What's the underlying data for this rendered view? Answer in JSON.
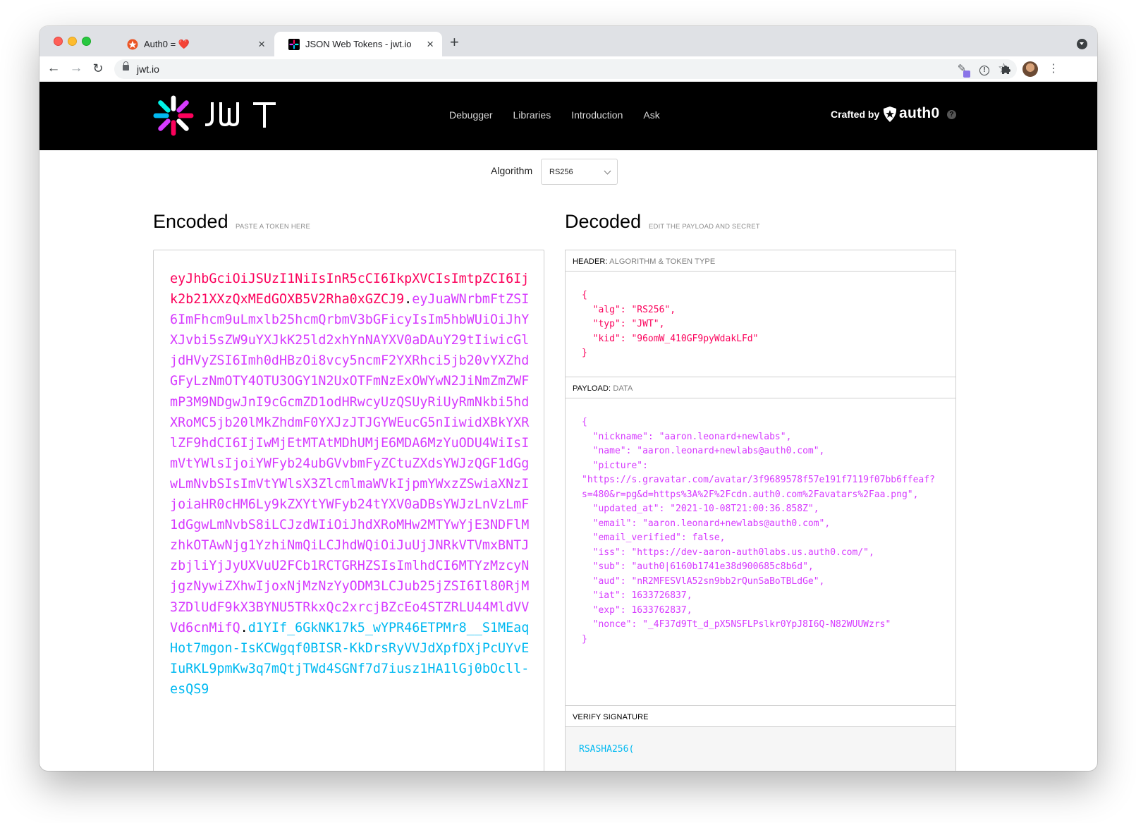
{
  "browser": {
    "tabs": [
      {
        "title": "Auth0 = ❤️",
        "active": false
      },
      {
        "title": "JSON Web Tokens - jwt.io",
        "active": true
      }
    ],
    "url": "jwt.io",
    "new_tab": "+",
    "close_glyph": "×"
  },
  "site": {
    "logo_text": "JWT",
    "nav": [
      "Debugger",
      "Libraries",
      "Introduction",
      "Ask"
    ],
    "crafted_by": "Crafted by",
    "auth0": "auth0",
    "help": "?"
  },
  "algorithm": {
    "label": "Algorithm",
    "value": "RS256"
  },
  "encoded": {
    "title": "Encoded",
    "subtitle": "PASTE A TOKEN HERE",
    "header_part": "eyJhbGciOiJSUzI1NiIsInR5cCI6IkpXVCIsImtpZCI6Ijk2b21XXzQxMEdGOXB5V2Rha0xGZCJ9",
    "payload_part": "eyJuaWNrbmFtZSI6ImFhcm9uLmxlb25hcmQrbmV3bGFicyIsIm5hbWUiOiJhYXJvbi5sZW9uYXJkK25ld2xhYnNAYXV0aDAuY29tIiwicGljdHVyZSI6Imh0dHBzOi8vcy5ncmF2YXRhci5jb20vYXZhdGFyLzNmOTY4OTU3OGY1N2UxOTFmNzExOWYwN2JiNmZmZWFmP3M9NDgwJnI9cGcmZD1odHRwcyUzQSUyRiUyRmNkbi5hdXRoMC5jb20lMkZhdmF0YXJzJTJGYWEucG5nIiwidXBkYXRlZF9hdCI6IjIwMjEtMTAtMDhUMjE6MDA6MzYuODU4WiIsImVtYWlsIjoiYWFyb24ubGVvbmFyZCtuZXdsYWJzQGF1dGgwLmNvbSIsImVtYWlsX3ZlcmlmaWVkIjpmYWxzZSwiaXNzIjoiaHR0cHM6Ly9kZXYtYWFyb24tYXV0aDBsYWJzLnVzLmF1dGgwLmNvbS8iLCJzdWIiOiJhdXRoMHw2MTYwYjE3NDFlMzhkOTAwNjg1YzhiNmQiLCJhdWQiOiJuUjJNRkVTVmxBNTJzbjliYjJyUXVuU2FCb1RCTGRHZSIsImlhdCI6MTYzMzcyNjgzNywiZXhwIjoxNjMzNzYyODM3LCJub25jZSI6Il80RjM3ZDlUdF9kX3BYNU5TRkxQc2xrcjBZcEo4STZRLU44MldVVVd6cnMifQ",
    "signature_part": "d1YIf_6GkNK17k5_wYPR46ETPMr8__S1MEaqHot7mgon-IsKCWgqf0BISR-KkDrsRyVVJdXpfDXjPcUYvEIuRKL9pmKw3q7mQtjTWd4SGNf7d7iusz1HA1lGj0bOcll-esQS9",
    "dot": "."
  },
  "decoded": {
    "title": "Decoded",
    "subtitle": "EDIT THE PAYLOAD AND SECRET",
    "header_label": "HEADER:",
    "header_desc": "ALGORITHM & TOKEN TYPE",
    "header_json": "{\n  \"alg\": \"RS256\",\n  \"typ\": \"JWT\",\n  \"kid\": \"96omW_410GF9pyWdakLFd\"\n}",
    "payload_label": "PAYLOAD:",
    "payload_desc": "DATA",
    "payload_json": "{\n  \"nickname\": \"aaron.leonard+newlabs\",\n  \"name\": \"aaron.leonard+newlabs@auth0.com\",\n  \"picture\":\n\"https://s.gravatar.com/avatar/3f9689578f57e191f7119f07bb6ffeaf?s=480&r=pg&d=https%3A%2F%2Fcdn.auth0.com%2Favatars%2Faa.png\",\n  \"updated_at\": \"2021-10-08T21:00:36.858Z\",\n  \"email\": \"aaron.leonard+newlabs@auth0.com\",\n  \"email_verified\": false,\n  \"iss\": \"https://dev-aaron-auth0labs.us.auth0.com/\",\n  \"sub\": \"auth0|6160b1741e38d900685c8b6d\",\n  \"aud\": \"nR2MFESVlA52sn9bb2rQunSaBoTBLdGe\",\n  \"iat\": 1633726837,\n  \"exp\": 1633762837,\n  \"nonce\": \"_4F37d9Tt_d_pX5NSFLPslkr0YpJ8I6Q-N82WUUWzrs\"\n}",
    "verify_label": "VERIFY SIGNATURE",
    "verify_text": "RSASHA256("
  },
  "colors": {
    "header": "#fb015b",
    "payload": "#d63aff",
    "signature": "#00b9f1"
  }
}
